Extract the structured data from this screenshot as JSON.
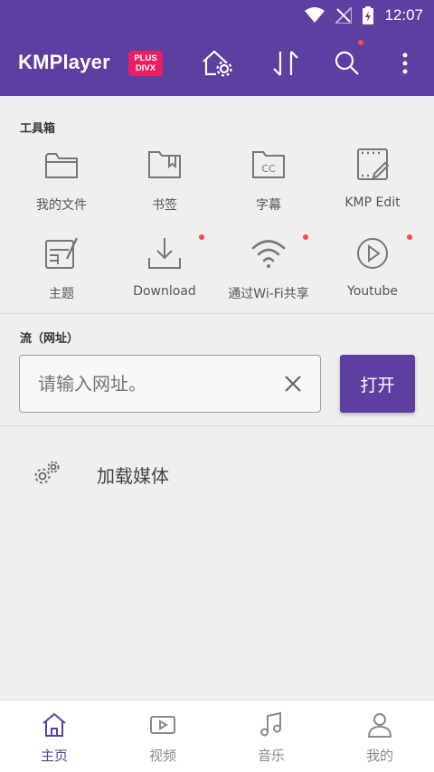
{
  "status_bar": {
    "time": "12:07"
  },
  "app_bar": {
    "logo": "KMPlayer",
    "badge_line1": "PLUS",
    "badge_line2": "DIVX",
    "icons": [
      "home-settings-icon",
      "sort-icon",
      "search-icon",
      "more-icon"
    ]
  },
  "toolbox": {
    "title": "工具箱",
    "items": [
      {
        "label": "我的文件",
        "icon": "folder-icon",
        "dot": false
      },
      {
        "label": "书签",
        "icon": "bookmark-folder-icon",
        "dot": false
      },
      {
        "label": "字幕",
        "icon": "subtitle-folder-icon",
        "dot": false
      },
      {
        "label": "KMP Edit",
        "icon": "video-edit-icon",
        "dot": false
      },
      {
        "label": "主题",
        "icon": "theme-icon",
        "dot": false
      },
      {
        "label": "Download",
        "icon": "download-icon",
        "dot": true
      },
      {
        "label": "通过Wi-Fi共享",
        "icon": "wifi-icon",
        "dot": true
      },
      {
        "label": "Youtube",
        "icon": "play-circle-icon",
        "dot": true
      }
    ]
  },
  "stream": {
    "title": "流（网址）",
    "placeholder": "请输入网址。",
    "open_label": "打开"
  },
  "load_media": {
    "label": "加载媒体"
  },
  "bottom_nav": [
    {
      "label": "主页",
      "icon": "home-icon",
      "active": true
    },
    {
      "label": "视频",
      "icon": "video-icon",
      "active": false
    },
    {
      "label": "音乐",
      "icon": "music-icon",
      "active": false
    },
    {
      "label": "我的",
      "icon": "user-icon",
      "active": false
    }
  ],
  "colors": {
    "primary": "#5c3fa0",
    "badge": "#e91e63",
    "dot": "#ff4a4a"
  }
}
